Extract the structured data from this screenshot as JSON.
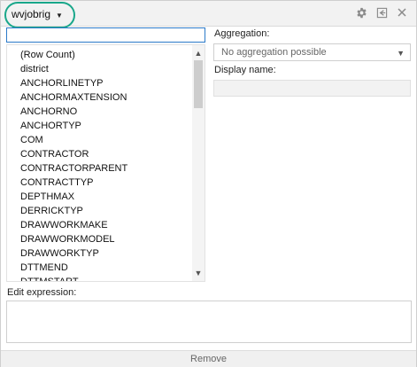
{
  "window": {
    "title": "wvjobrig"
  },
  "toolbar": {
    "icons": [
      "gear-icon",
      "pin-icon",
      "close-icon"
    ]
  },
  "search": {
    "value": ""
  },
  "fields": [
    "(Row Count)",
    "district",
    "ANCHORLINETYP",
    "ANCHORMAXTENSION",
    "ANCHORNO",
    "ANCHORTYP",
    "COM",
    "CONTRACTOR",
    "CONTRACTORPARENT",
    "CONTRACTTYP",
    "DEPTHMAX",
    "DERRICKTYP",
    "DRAWWORKMAKE",
    "DRAWWORKMODEL",
    "DRAWWORKTYP",
    "DTTMEND",
    "DTTMSTART"
  ],
  "aggregation": {
    "label": "Aggregation:",
    "value": "No aggregation possible"
  },
  "display_name": {
    "label": "Display name:",
    "value": ""
  },
  "expression": {
    "label": "Edit expression:",
    "value": ""
  },
  "remove_label": "Remove",
  "colors": {
    "highlight": "#19a78a",
    "focus_border": "#2b7ac9"
  }
}
